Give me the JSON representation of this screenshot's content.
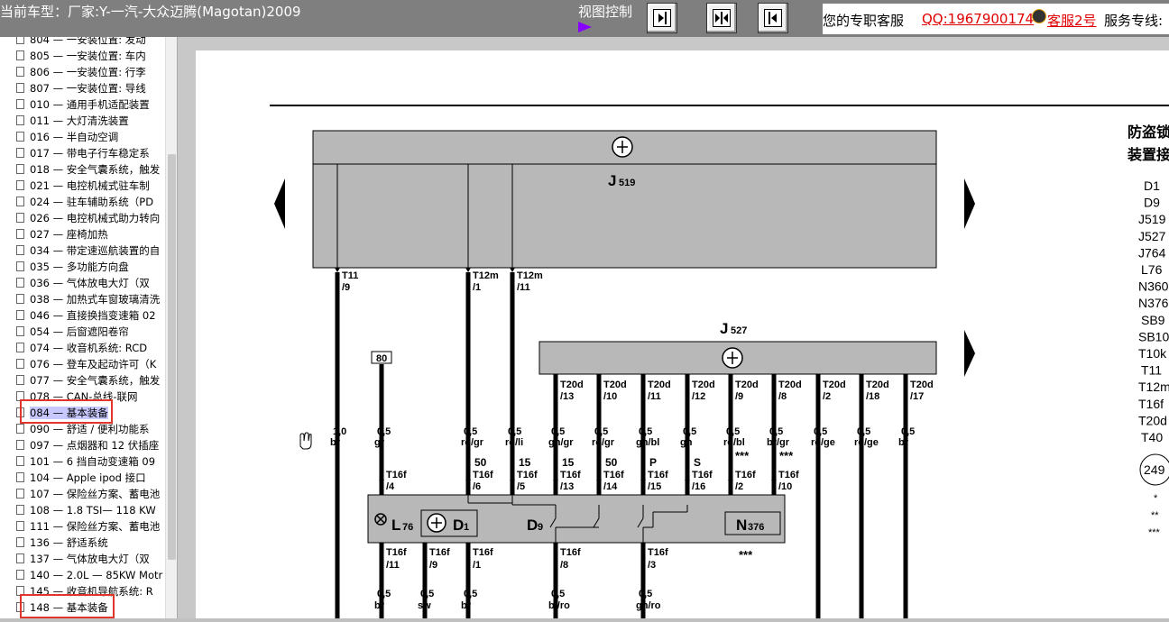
{
  "topbar": {
    "car_title": "当前车型：厂家:Y-一汽-大众迈腾(Magotan)2009",
    "view_label": "视图控制",
    "service_text": "您的专职客服",
    "qq_text": "QQ:1967900174",
    "kefu_text": "客服2号",
    "hotline_text": "服务专线:"
  },
  "sidebar": {
    "items": [
      "804 — 一安装位置:  发动",
      "805 — 一安装位置:  车内",
      "806 — 一安装位置:  行李",
      "807 — 一安装位置:  导线",
      "010 — 通用手机适配装置",
      "011 — 大灯清洗装置",
      "016 — 半自动空调",
      "017 — 带电子行车稳定系",
      "018 — 安全气囊系统，触发",
      "021 — 电控机械式驻车制",
      "024 — 驻车辅助系统（PD",
      "026 — 电控机械式助力转向",
      "027 — 座椅加热",
      "034 — 带定速巡航装置的自",
      "035 — 多功能方向盘",
      "036 — 气体放电大灯（双",
      "038 — 加热式车窗玻璃清洗",
      "046 — 直接换挡变速箱 02",
      "054 — 后窗遮阳卷帘",
      "074 — 收音机系统:  RCD",
      "076 — 登车及起动许可（K",
      "077 — 安全气囊系统，触发",
      "078 — CAN-总线-联网",
      "084 — 基本装备",
      "090 — 舒适 / 便利功能系",
      "097 — 点烟器和 12 伏插座",
      "101 — 6 挡自动变速箱 09",
      "104 — Apple ipod 接口",
      "107 — 保险丝方案、蓄电池",
      "108 — 1.8 TSI— 118 KW",
      "111 — 保险丝方案、蓄电池",
      "136 — 舒适系统",
      "137 — 气体放电大灯（双",
      "140 — 2.0L — 85KW Motr",
      "145 — 收音机导航系统:  R",
      "148 — 基本装备"
    ]
  },
  "diagram": {
    "j519": "J",
    "j519_sub": "519",
    "j527": "J",
    "j527_sub": "527",
    "top_pins": [
      {
        "a": "T11",
        "b": "/9"
      },
      {
        "a": "T12m",
        "b": "/1"
      },
      {
        "a": "T12m",
        "b": "/11"
      }
    ],
    "j527_pins": [
      {
        "a": "T20d",
        "b": "/13"
      },
      {
        "a": "T20d",
        "b": "/10"
      },
      {
        "a": "T20d",
        "b": "/11"
      },
      {
        "a": "T20d",
        "b": "/12"
      },
      {
        "a": "T20d",
        "b": "/9"
      },
      {
        "a": "T20d",
        "b": "/8"
      },
      {
        "a": "T20d",
        "b": "/2"
      },
      {
        "a": "T20d",
        "b": "/18"
      },
      {
        "a": "T20d",
        "b": "/17"
      }
    ],
    "box80": "80",
    "wires": [
      {
        "a": "1,0",
        "b": "br"
      },
      {
        "a": "0,5",
        "b": "gr"
      },
      {
        "a": "0,5",
        "b": "ro/gr"
      },
      {
        "a": "0,5",
        "b": "ro/li"
      },
      {
        "a": "0,5",
        "b": "gn/gr"
      },
      {
        "a": "0,5",
        "b": "ro/gr"
      },
      {
        "a": "0,5",
        "b": "gn/bl"
      },
      {
        "a": "0,5",
        "b": "gn"
      },
      {
        "a": "0,5",
        "b": "ro/bl"
      },
      {
        "a": "0,5",
        "b": "br/gr"
      },
      {
        "a": "0,5",
        "b": "ro/ge"
      },
      {
        "a": "0,5",
        "b": "ro/ge"
      },
      {
        "a": "0,5",
        "b": "br"
      }
    ],
    "sw_labels": [
      "50",
      "15",
      "15",
      "50",
      "P",
      "S"
    ],
    "stars": "***",
    "t16f_top": [
      {
        "a": "T16f",
        "b": "/4"
      },
      {
        "a": "T16f",
        "b": "/6"
      },
      {
        "a": "T16f",
        "b": "/5"
      },
      {
        "a": "T16f",
        "b": "/13"
      },
      {
        "a": "T16f",
        "b": "/14"
      },
      {
        "a": "T16f",
        "b": "/15"
      },
      {
        "a": "T16f",
        "b": "/16"
      },
      {
        "a": "T16f",
        "b": "/2"
      },
      {
        "a": "T16f",
        "b": "/10"
      }
    ],
    "l76": "L",
    "l76_sub": "76",
    "d1": "D",
    "d1_sub": "1",
    "d9": "D",
    "d9_sub": "9",
    "n376": "N",
    "n376_sub": "376",
    "t16f_bottom": [
      {
        "a": "T16f",
        "b": "/11"
      },
      {
        "a": "T16f",
        "b": "/9"
      },
      {
        "a": "T16f",
        "b": "/1"
      },
      {
        "a": "T16f",
        "b": "/8"
      },
      {
        "a": "T16f",
        "b": "/3"
      }
    ],
    "bottom_wires": [
      {
        "a": "0,5",
        "b": "br"
      },
      {
        "a": "0,5",
        "b": "sw"
      },
      {
        "a": "0,5",
        "b": "br"
      },
      {
        "a": "0,5",
        "b": "bl/ro"
      },
      {
        "a": "0,5",
        "b": "gn/ro"
      }
    ]
  },
  "legend": {
    "title1": "防盗锁",
    "title2": "装置接",
    "items": [
      "D1",
      "D9",
      "J519",
      "J527",
      "J764",
      "L76",
      "N360",
      "N376",
      "SB9",
      "SB10",
      "T10k",
      "T11",
      "T12m",
      "T16f",
      "T20d",
      "T40"
    ],
    "circle": "249",
    "star1": "*",
    "star2": "**",
    "star3": "***"
  }
}
